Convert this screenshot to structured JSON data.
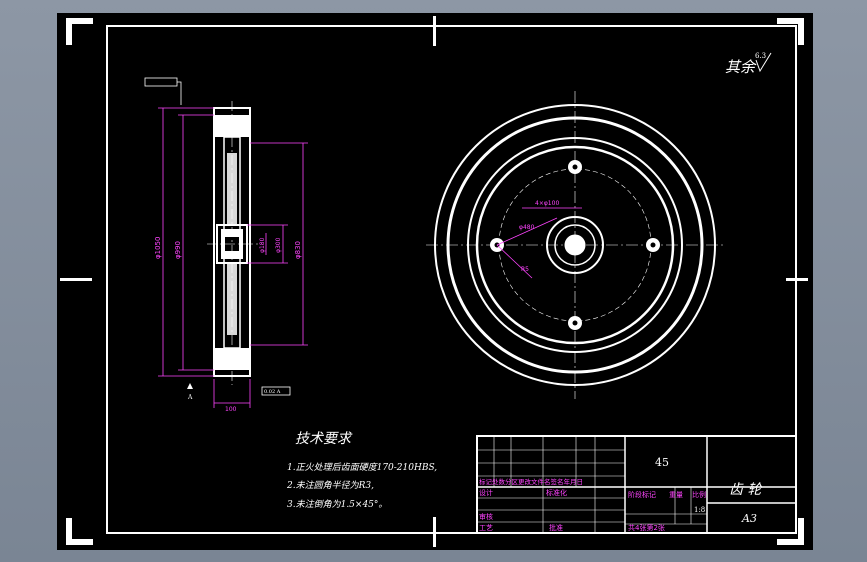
{
  "drawing": {
    "roughness_note": "其余",
    "roughness_value": "6.3",
    "tech_title": "技术要求",
    "tech_items": [
      "1.正火处理后齿面硬度170-210HBS,",
      "2.未注圆角半径为R3,",
      "3.未注倒角为1.5×45°。"
    ]
  },
  "title_block": {
    "material": "45",
    "part_name": "齿  轮",
    "sheet_size": "A3",
    "scale": "1:8",
    "revision_header": "标记处数分区更改文件名签名年月日",
    "design": "设计",
    "standardize": "标准化",
    "stage_mark": "阶段标记",
    "weight": "重量",
    "ratio": "比例",
    "review": "审核",
    "process": "工艺",
    "approve": "批准",
    "sheet_count": "共4张第2张"
  },
  "dims": {
    "d1": "φ1050",
    "d2": "φ990",
    "d3": "φ830",
    "d4": "φ300",
    "d5": "φ180",
    "width": "100",
    "hole": "4×φ100",
    "pcd": "φ480",
    "r": "R5",
    "tol": "0.02 A",
    "datum": "A"
  },
  "colors": {
    "sheet": "#000000",
    "line": "#ffffff",
    "dimension": "#ff44ff"
  }
}
